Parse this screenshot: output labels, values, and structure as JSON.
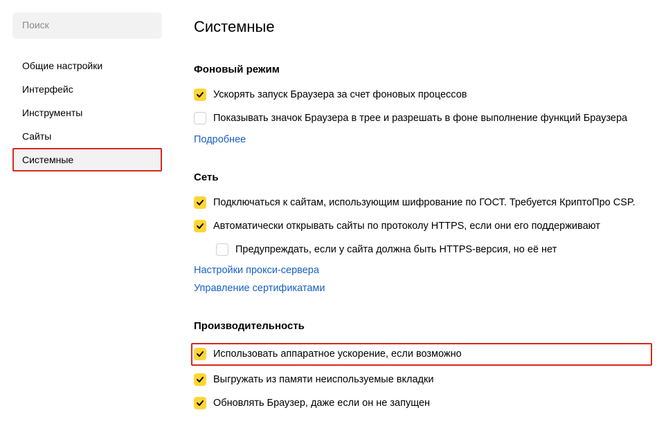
{
  "sidebar": {
    "search_placeholder": "Поиск",
    "items": [
      {
        "label": "Общие настройки",
        "active": false
      },
      {
        "label": "Интерфейс",
        "active": false
      },
      {
        "label": "Инструменты",
        "active": false
      },
      {
        "label": "Сайты",
        "active": false
      },
      {
        "label": "Системные",
        "active": true
      }
    ]
  },
  "main": {
    "title": "Системные",
    "sections": [
      {
        "title": "Фоновый режим",
        "options": [
          {
            "label": "Ускорять запуск Браузера за счет фоновых процессов",
            "checked": true,
            "highlighted": false,
            "indented": false
          },
          {
            "label": "Показывать значок Браузера в трее и разрешать в фоне выполнение функций Браузера",
            "checked": false,
            "highlighted": false,
            "indented": false
          }
        ],
        "links": [
          {
            "label": "Подробнее"
          }
        ]
      },
      {
        "title": "Сеть",
        "options": [
          {
            "label": "Подключаться к сайтам, использующим шифрование по ГОСТ. Требуется КриптоПро CSP.",
            "checked": true,
            "highlighted": false,
            "indented": false
          },
          {
            "label": "Автоматически открывать сайты по протоколу HTTPS, если они его поддерживают",
            "checked": true,
            "highlighted": false,
            "indented": false
          },
          {
            "label": "Предупреждать, если у сайта должна быть HTTPS-версия, но её нет",
            "checked": false,
            "highlighted": false,
            "indented": true
          }
        ],
        "links": [
          {
            "label": "Настройки прокси-сервера"
          },
          {
            "label": "Управление сертификатами"
          }
        ]
      },
      {
        "title": "Производительность",
        "options": [
          {
            "label": "Использовать аппаратное ускорение, если возможно",
            "checked": true,
            "highlighted": true,
            "indented": false
          },
          {
            "label": "Выгружать из памяти неиспользуемые вкладки",
            "checked": true,
            "highlighted": false,
            "indented": false
          },
          {
            "label": "Обновлять Браузер, даже если он не запущен",
            "checked": true,
            "highlighted": false,
            "indented": false
          }
        ],
        "links": []
      }
    ]
  }
}
